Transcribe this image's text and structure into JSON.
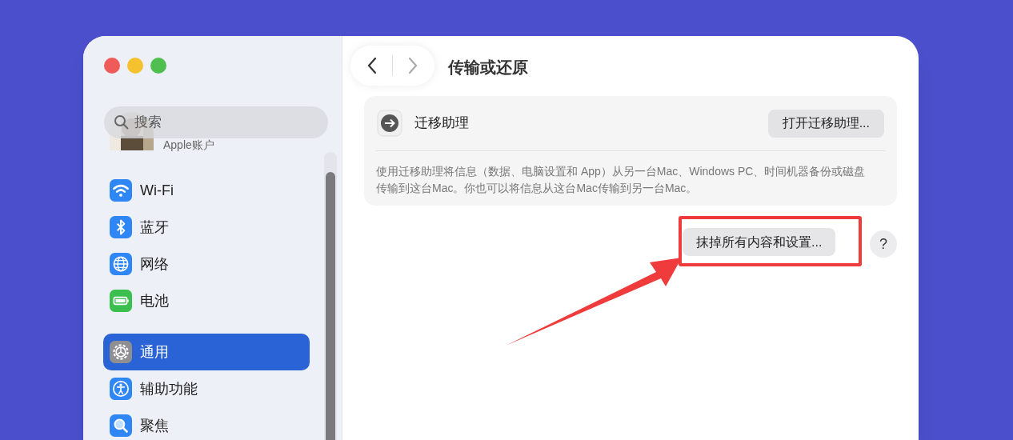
{
  "sidebar": {
    "search": {
      "placeholder": "搜索"
    },
    "account": {
      "label": "Apple账户"
    },
    "groups": [
      [
        {
          "label": "Wi-Fi",
          "kind": "wifi",
          "selected": false
        },
        {
          "label": "蓝牙",
          "kind": "bluetooth",
          "selected": false
        },
        {
          "label": "网络",
          "kind": "globe",
          "selected": false
        },
        {
          "label": "电池",
          "kind": "battery",
          "selected": false
        }
      ],
      [
        {
          "label": "通用",
          "kind": "gear",
          "selected": true
        },
        {
          "label": "辅助功能",
          "kind": "accessibility",
          "selected": false
        },
        {
          "label": "聚焦",
          "kind": "spotlight",
          "selected": false
        }
      ]
    ]
  },
  "toolbar": {
    "title": "传输或还原"
  },
  "migration_card": {
    "label": "迁移助理",
    "button": "打开迁移助理...",
    "description": "使用迁移助理将信息（数据、电脑设置和 App）从另一台Mac、Windows PC、时间机器备份或磁盘传输到这台Mac。你也可以将信息从这台Mac传输到另一台Mac。"
  },
  "erase_button": "抹掉所有内容和设置...",
  "help_button": "?"
}
